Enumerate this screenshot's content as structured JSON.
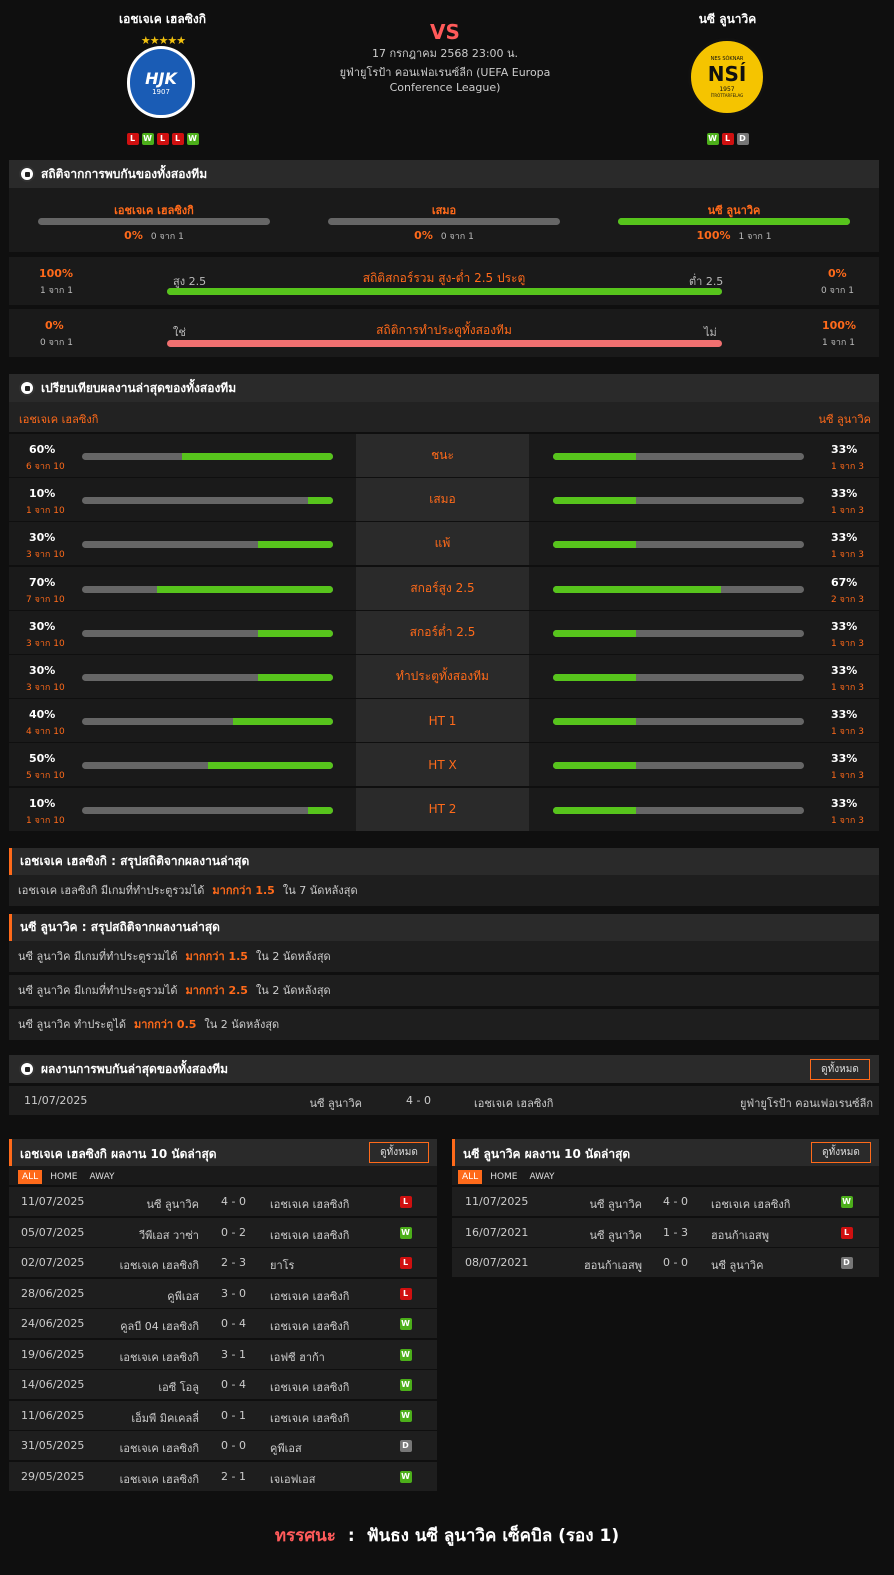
{
  "header": {
    "home": "เอชเจเค เฮลซิงกิ",
    "away": "นซี ลูนาวิค",
    "vs": "VS",
    "datetime": "17 กรกฎาคม 2568 23:00 น.",
    "competition_line1": "ยูฟ่ายูโรป้า คอนเฟอเรนซ์ลีก (UEFA Europa",
    "competition_line2": "Conference League)",
    "home_form": [
      "L",
      "W",
      "L",
      "L",
      "W"
    ],
    "away_form": [
      "W",
      "L",
      "D"
    ],
    "home_crest_text": "HJK",
    "home_crest_year": "1907",
    "away_crest_text": "NSÍ",
    "away_crest_top": "NES SÓKNAR",
    "away_crest_year": "1957",
    "away_crest_bottom": "ÍTRÓTTARFELAG"
  },
  "h2h": {
    "title": "สถิติจากการพบกันของทั้งสองทีม",
    "cols": [
      {
        "label": "เอชเจเค เฮลซิงกิ",
        "pct": "0%",
        "sub": "0 จาก 1",
        "fill": 0
      },
      {
        "label": "เสมอ",
        "pct": "0%",
        "sub": "0 จาก 1",
        "fill": 0
      },
      {
        "label": "นซี ลูนาวิค",
        "pct": "100%",
        "sub": "1 จาก 1",
        "fill": 1
      }
    ],
    "ou": {
      "title": "สถิติสกอร์รวม สูง-ต่ำ 2.5 ประตู",
      "lpct": "100%",
      "lsub": "1 จาก 1",
      "rpct": "0%",
      "rsub": "0 จาก 1",
      "lk": "สูง 2.5",
      "rk": "ต่ำ 2.5"
    },
    "btts": {
      "title": "สถิติการทำประตูทั้งสองทีม",
      "lpct": "0%",
      "lsub": "0 จาก 1",
      "rpct": "100%",
      "rsub": "1 จาก 1",
      "lk": "ใช่",
      "rk": "ไม่"
    }
  },
  "compare": {
    "title": "เปรียบเทียบผลงานล่าสุดของทั้งสองทีม",
    "home": "เอชเจเค เฮลซิงกิ",
    "away": "นซี ลูนาวิค",
    "rows": [
      {
        "label": "ชนะ",
        "lp": "60%",
        "ls": "6 จาก 10",
        "lf": 0.6,
        "rp": "33%",
        "rs": "1 จาก 3",
        "rf": 0.33
      },
      {
        "label": "เสมอ",
        "lp": "10%",
        "ls": "1 จาก 10",
        "lf": 0.1,
        "rp": "33%",
        "rs": "1 จาก 3",
        "rf": 0.33
      },
      {
        "label": "แพ้",
        "lp": "30%",
        "ls": "3 จาก 10",
        "lf": 0.3,
        "rp": "33%",
        "rs": "1 จาก 3",
        "rf": 0.33
      },
      {
        "label": "สกอร์สูง 2.5",
        "lp": "70%",
        "ls": "7 จาก 10",
        "lf": 0.7,
        "rp": "67%",
        "rs": "2 จาก 3",
        "rf": 0.67
      },
      {
        "label": "สกอร์ต่ำ 2.5",
        "lp": "30%",
        "ls": "3 จาก 10",
        "lf": 0.3,
        "rp": "33%",
        "rs": "1 จาก 3",
        "rf": 0.33
      },
      {
        "label": "ทำประตูทั้งสองทีม",
        "lp": "30%",
        "ls": "3 จาก 10",
        "lf": 0.3,
        "rp": "33%",
        "rs": "1 จาก 3",
        "rf": 0.33
      },
      {
        "label": "HT 1",
        "lp": "40%",
        "ls": "4 จาก 10",
        "lf": 0.4,
        "rp": "33%",
        "rs": "1 จาก 3",
        "rf": 0.33
      },
      {
        "label": "HT X",
        "lp": "50%",
        "ls": "5 จาก 10",
        "lf": 0.5,
        "rp": "33%",
        "rs": "1 จาก 3",
        "rf": 0.33
      },
      {
        "label": "HT 2",
        "lp": "10%",
        "ls": "1 จาก 10",
        "lf": 0.1,
        "rp": "33%",
        "rs": "1 จาก 3",
        "rf": 0.33
      }
    ]
  },
  "summary_home": {
    "title": "เอชเจเค เฮลซิงกิ : สรุปสถิติจากผลงานล่าสุด",
    "rows": [
      {
        "pre": "เอชเจเค เฮลซิงกิ  มีเกมที่ทำประตูรวมได้",
        "hl": "มากกว่า  1.5",
        "post": "ใน 7 นัดหลังสุด"
      }
    ]
  },
  "summary_away": {
    "title": "นซี ลูนาวิค : สรุปสถิติจากผลงานล่าสุด",
    "rows": [
      {
        "pre": "นซี ลูนาวิค  มีเกมที่ทำประตูรวมได้",
        "hl": "มากกว่า  1.5",
        "post": "ใน 2 นัดหลังสุด"
      },
      {
        "pre": "นซี ลูนาวิค  มีเกมที่ทำประตูรวมได้",
        "hl": "มากกว่า  2.5",
        "post": "ใน 2 นัดหลังสุด"
      },
      {
        "pre": "นซี ลูนาวิค  ทำประตูได้",
        "hl": "มากกว่า  0.5",
        "post": "ใน 2 นัดหลังสุด"
      }
    ]
  },
  "h2h_results": {
    "title": "ผลงานการพบกันล่าสุดของทั้งสองทีม",
    "btn": "ดูทั้งหมด",
    "rows": [
      {
        "date": "11/07/2025",
        "home": "นซี ลูนาวิค",
        "score": "4 - 0",
        "away": "เอชเจเค เฮลซิงกิ",
        "comp": "ยูฟ่ายูโรป้า คอนเฟอเรนซ์ลีก"
      }
    ]
  },
  "home_last": {
    "title": "เอชเจเค เฮลซิงกิ ผลงาน 10 นัดล่าสุด",
    "btn": "ดูทั้งหมด",
    "tabs": [
      "ALL",
      "HOME",
      "AWAY"
    ],
    "rows": [
      {
        "date": "11/07/2025",
        "home": "นซี ลูนาวิค",
        "score": "4 - 0",
        "away": "เอชเจเค เฮลซิงกิ",
        "r": "L"
      },
      {
        "date": "05/07/2025",
        "home": "วีพีเอส วาซ่า",
        "score": "0 - 2",
        "away": "เอชเจเค เฮลซิงกิ",
        "r": "W"
      },
      {
        "date": "02/07/2025",
        "home": "เอชเจเค เฮลซิงกิ",
        "score": "2 - 3",
        "away": "ยาโร",
        "r": "L"
      },
      {
        "date": "28/06/2025",
        "home": "คูพีเอส",
        "score": "3 - 0",
        "away": "เอชเจเค เฮลซิงกิ",
        "r": "L"
      },
      {
        "date": "24/06/2025",
        "home": "คูลบี 04 เฮลซิงกิ",
        "score": "0 - 4",
        "away": "เอชเจเค เฮลซิงกิ",
        "r": "W"
      },
      {
        "date": "19/06/2025",
        "home": "เอชเจเค เฮลซิงกิ",
        "score": "3 - 1",
        "away": "เอฟซี ฮาก้า",
        "r": "W"
      },
      {
        "date": "14/06/2025",
        "home": "เอซี โอลู",
        "score": "0 - 4",
        "away": "เอชเจเค เฮลซิงกิ",
        "r": "W"
      },
      {
        "date": "11/06/2025",
        "home": "เอ็มพี มิคเคลลี่",
        "score": "0 - 1",
        "away": "เอชเจเค เฮลซิงกิ",
        "r": "W"
      },
      {
        "date": "31/05/2025",
        "home": "เอชเจเค เฮลซิงกิ",
        "score": "0 - 0",
        "away": "คูพีเอส",
        "r": "D"
      },
      {
        "date": "29/05/2025",
        "home": "เอชเจเค เฮลซิงกิ",
        "score": "2 - 1",
        "away": "เจเอฟเอส",
        "r": "W"
      }
    ]
  },
  "away_last": {
    "title": "นซี ลูนาวิค ผลงาน 10 นัดล่าสุด",
    "btn": "ดูทั้งหมด",
    "tabs": [
      "ALL",
      "HOME",
      "AWAY"
    ],
    "rows": [
      {
        "date": "11/07/2025",
        "home": "นซี ลูนาวิค",
        "score": "4 - 0",
        "away": "เอชเจเค เฮลซิงกิ",
        "r": "W"
      },
      {
        "date": "16/07/2021",
        "home": "นซี ลูนาวิค",
        "score": "1 - 3",
        "away": "ฮอนก้าเอสพู",
        "r": "L"
      },
      {
        "date": "08/07/2021",
        "home": "ฮอนก้าเอสพู",
        "score": "0 - 0",
        "away": "นซี ลูนาวิค",
        "r": "D"
      }
    ]
  },
  "prediction": {
    "label": "ทรรศนะ",
    "sep": ":",
    "text": "ฟันธง นซี ลูนาวิค เซ็คบิล (รอง 1)"
  }
}
